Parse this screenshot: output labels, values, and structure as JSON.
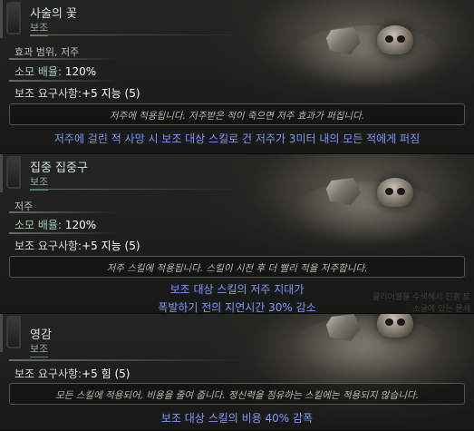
{
  "tooltips": [
    {
      "name": "사술의 꽃",
      "tag": "보조",
      "stats_small": "효과 범위, 저주",
      "stats": [
        {
          "key": "소모 배율:",
          "value": " 120%"
        },
        {
          "key": "보조 요구사항:",
          "value": "+5 지능 (5)"
        }
      ],
      "description": "저주에 적용됩니다. 저주받은 적이 죽으면 저주 효과가 퍼집니다.",
      "effects": [
        "저주에 걸린 적 사망 시 보조 대상 스킬로 건 저주가 3미터 내의 모든 적에게 퍼짐"
      ]
    },
    {
      "name": "집중 집중구",
      "tag": "보조",
      "stats_small": "저주",
      "stats": [
        {
          "key": "소모 배율:",
          "value": " 120%"
        },
        {
          "key": "보조 요구사항:",
          "value": "+5 지능 (5)"
        }
      ],
      "description": "저주 스킬에 적용됩니다. 스킬이 시전 후 더 빨리 적을 저주합니다.",
      "effects": [
        "보조 대상 스킬의 저주 지대가",
        "폭발하기 전의 지연시간 30% 감소"
      ],
      "ghost_lines": [
        "클리어웰을 수색해서 진흙 토",
        "소굴에 있는 문세"
      ]
    },
    {
      "name": "영감",
      "tag": "보조",
      "stats": [
        {
          "key": "보조 요구사항:",
          "value": "+5 힘 (5)"
        }
      ],
      "description": "모든 스킬에 적용되어, 비용을 줄여 줍니다. 정신력을 점유하는 스킬에는 적용되지 않습니다.",
      "effects": [
        "보조 대상 스킬의 비용 40% 감폭"
      ]
    }
  ]
}
